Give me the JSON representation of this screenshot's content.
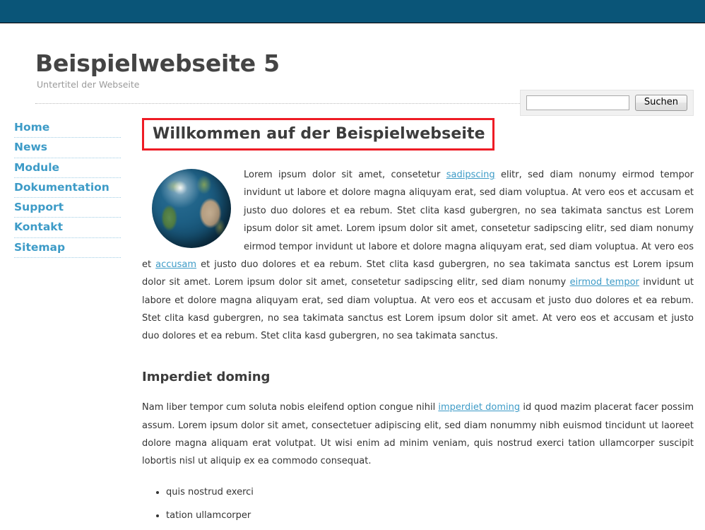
{
  "colors": {
    "topbar": "#0a5578",
    "link": "#3d9bc7",
    "highlight_border": "#ee1c25",
    "title": "#444444",
    "subtitle": "#9a9a9a"
  },
  "header": {
    "site_title": "Beispielwebseite 5",
    "site_subtitle": "Untertitel der Webseite"
  },
  "search": {
    "value": "",
    "placeholder": "",
    "button_label": "Suchen"
  },
  "sidebar": {
    "items": [
      {
        "label": "Home"
      },
      {
        "label": "News"
      },
      {
        "label": "Module"
      },
      {
        "label": "Dokumentation"
      },
      {
        "label": "Support"
      },
      {
        "label": "Kontakt"
      },
      {
        "label": "Sitemap"
      }
    ]
  },
  "content": {
    "welcome_heading": "Willkommen auf der Beispielwebseite",
    "globe_alt": "globe-image",
    "intro": {
      "part1": "Lorem ipsum dolor sit amet, consetetur ",
      "link1": "sadipscing",
      "part2": " elitr, sed diam nonumy eirmod tempor invidunt ut labore et dolore magna aliquyam erat, sed diam voluptua. At vero eos et accusam et justo duo dolores et ea rebum. Stet clita kasd gubergren, no sea takimata sanctus est Lorem ipsum dolor sit amet. Lorem ipsum dolor sit amet, consetetur sadipscing elitr, sed diam nonumy eirmod tempor invidunt ut labore et dolore magna aliquyam erat, sed diam voluptua. At vero eos et ",
      "link2": "accusam",
      "part3": " et justo duo dolores et ea rebum. Stet clita kasd gubergren, no sea takimata sanctus est Lorem ipsum dolor sit amet. Lorem ipsum dolor sit amet, consetetur sadipscing elitr, sed diam nonumy ",
      "link3": "eirmod tempor",
      "part4": " invidunt ut labore et dolore magna aliquyam erat, sed diam voluptua. At vero eos et accusam et justo duo dolores et ea rebum. Stet clita kasd gubergren, no sea takimata sanctus est Lorem ipsum dolor sit amet. At vero eos et accusam et justo duo dolores et ea rebum. Stet clita kasd gubergren, no sea takimata sanctus."
    },
    "section2_heading": "Imperdiet doming",
    "imperdiet": {
      "part1": "Nam liber tempor cum soluta nobis eleifend option congue nihil ",
      "link1": "imperdiet doming",
      "part2": " id quod mazim placerat facer possim assum. Lorem ipsum dolor sit amet, consectetuer adipiscing elit, sed diam nonummy nibh euismod tincidunt ut laoreet dolore magna aliquam erat volutpat. Ut wisi enim ad minim veniam, quis nostrud exerci tation ullamcorper suscipit lobortis nisl ut aliquip ex ea commodo consequat."
    },
    "bullets": [
      "quis nostrud exerci",
      "tation ullamcorper"
    ]
  }
}
